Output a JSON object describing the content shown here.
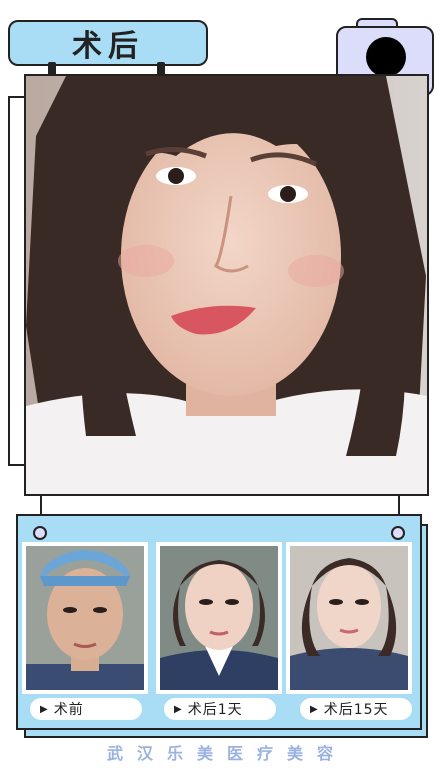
{
  "title": "术后",
  "comparisons": [
    {
      "label": "术前"
    },
    {
      "label": "术后1天"
    },
    {
      "label": "术后15天"
    }
  ],
  "footer": "武汉乐美医疗美容",
  "colors": {
    "title_bg": "#a9dcf5",
    "card_bg": "#a9dcf5",
    "camera_bg": "#dcdcfb",
    "footer_text": "#9ab2e0",
    "outline": "#222222"
  },
  "icons": {
    "camera": "camera-icon",
    "arrow": "play-arrow-icon"
  }
}
